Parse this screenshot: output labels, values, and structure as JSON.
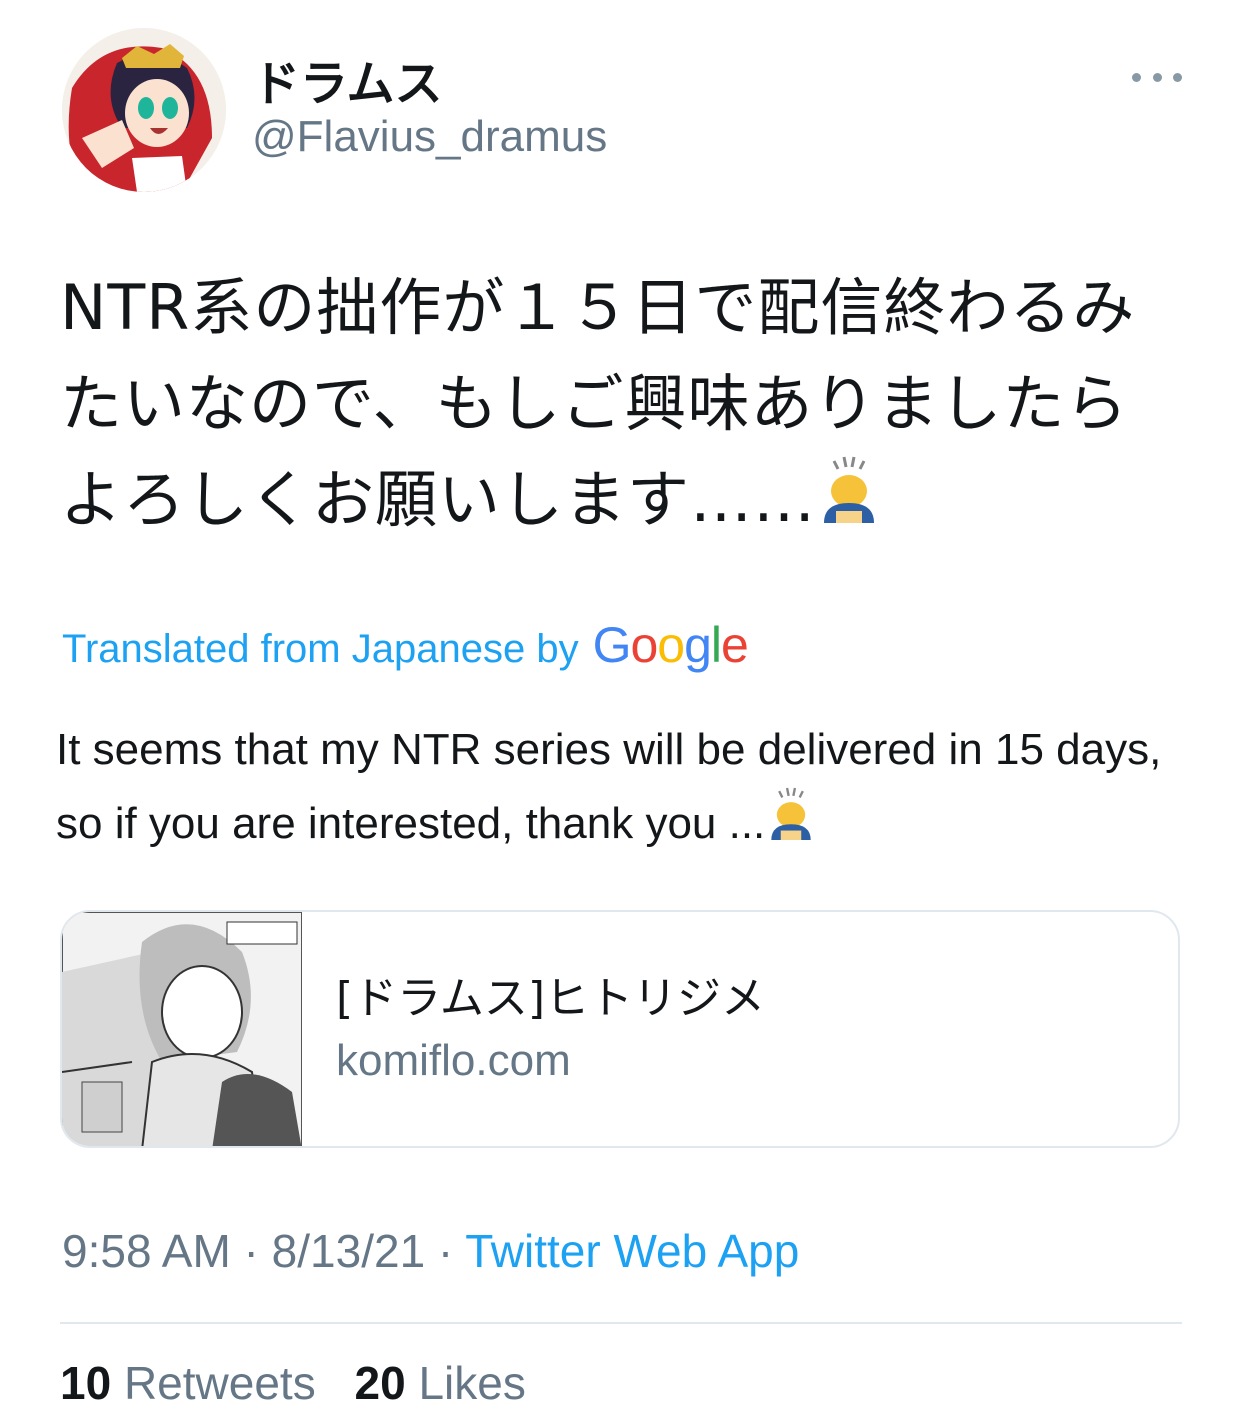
{
  "tweet": {
    "display_name": "ドラムス",
    "handle": "@Flavius_dramus",
    "text": "NTR系の拙作が１５日で配信終わるみたいなので、もしご興味ありましたらよろしくお願いします……",
    "text_emoji": "🙇",
    "translated_from": "Translated from Japanese by",
    "translator": "Google",
    "translation": "It seems that my NTR series will be delivered in 15 days, so if you are interested, thank you ...",
    "translation_emoji": "🙇"
  },
  "card": {
    "title": "[ドラムス]ヒトリジメ",
    "domain": "komiflo.com"
  },
  "meta": {
    "time": "9:58 AM",
    "separator1": " · ",
    "date": "8/13/21",
    "separator2": " · ",
    "source": "Twitter Web App"
  },
  "stats": {
    "retweets_count": "10",
    "retweets_label": "Retweets",
    "likes_count": "20",
    "likes_label": "Likes"
  },
  "colors": {
    "accent": "#1da1f2",
    "secondary_text": "#657786",
    "border": "#e1e8ed",
    "google_blue": "#4285f4",
    "google_red": "#ea4335",
    "google_yellow": "#fbbc05",
    "google_green": "#34a853"
  },
  "icons": {
    "more": "more-dots-icon",
    "emoji": "person-bowing-emoji"
  }
}
